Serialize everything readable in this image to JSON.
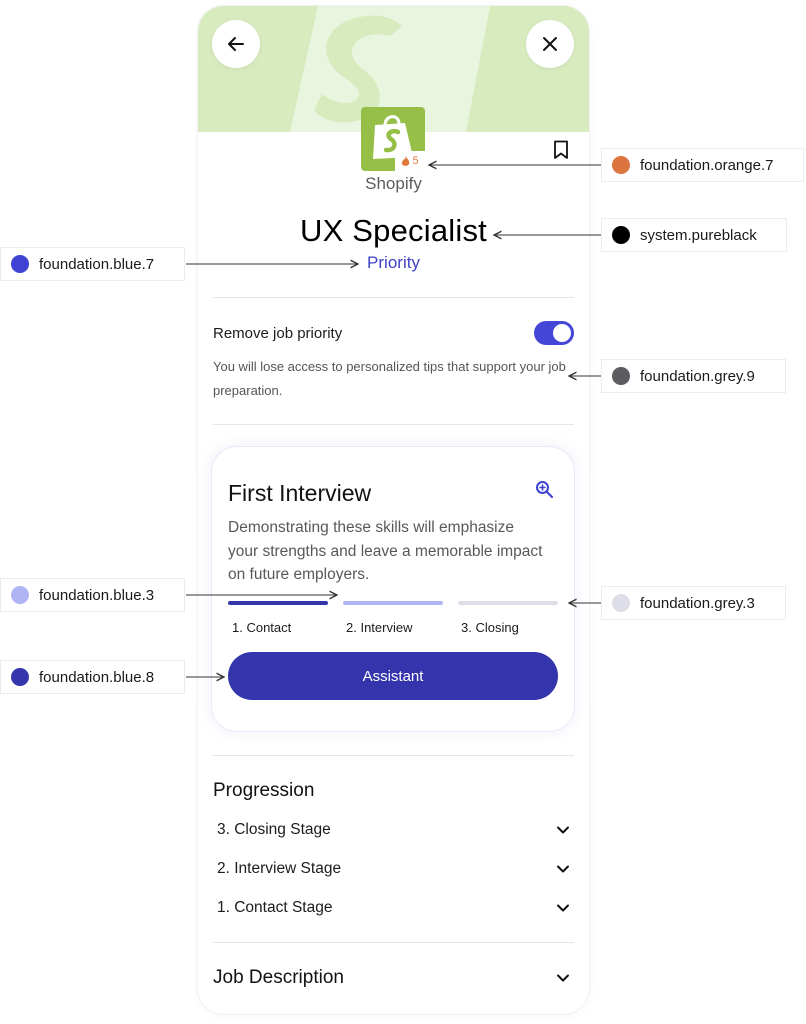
{
  "company": {
    "name": "Shopify",
    "badge_count": "5"
  },
  "job": {
    "title": "UX Specialist",
    "status": "Priority"
  },
  "priority_toggle": {
    "label": "Remove job priority",
    "description": "You will lose access to personalized tips that support your job preparation.",
    "on": true
  },
  "interview_card": {
    "title": "First Interview",
    "description": "Demonstrating these skills will emphasize your strengths and leave a memorable impact on future employers.",
    "steps": [
      {
        "label": "1. Contact",
        "state": "complete"
      },
      {
        "label": "2. Interview",
        "state": "current"
      },
      {
        "label": "3. Closing",
        "state": "upcoming"
      }
    ],
    "button_label": "Assistant"
  },
  "progression": {
    "title": "Progression",
    "items": [
      "3. Closing Stage",
      "2. Interview Stage",
      "1. Contact Stage"
    ]
  },
  "job_description": {
    "title": "Job Description"
  },
  "annotations": [
    {
      "label": "foundation.orange.7",
      "color": "#dd7440"
    },
    {
      "label": "system.pureblack",
      "color": "#000000"
    },
    {
      "label": "foundation.blue.7",
      "color": "#3f43d4"
    },
    {
      "label": "foundation.grey.9",
      "color": "#5c5c60"
    },
    {
      "label": "foundation.blue.3",
      "color": "#b1b4f3"
    },
    {
      "label": "foundation.grey.3",
      "color": "#dedee8"
    },
    {
      "label": "foundation.blue.8",
      "color": "#3535ad"
    }
  ],
  "icons": {
    "back": "arrow-left-icon",
    "close": "close-icon",
    "bookmark": "bookmark-icon",
    "search": "zoom-in-icon",
    "flame": "flame-icon",
    "chevron": "chevron-down-icon"
  }
}
